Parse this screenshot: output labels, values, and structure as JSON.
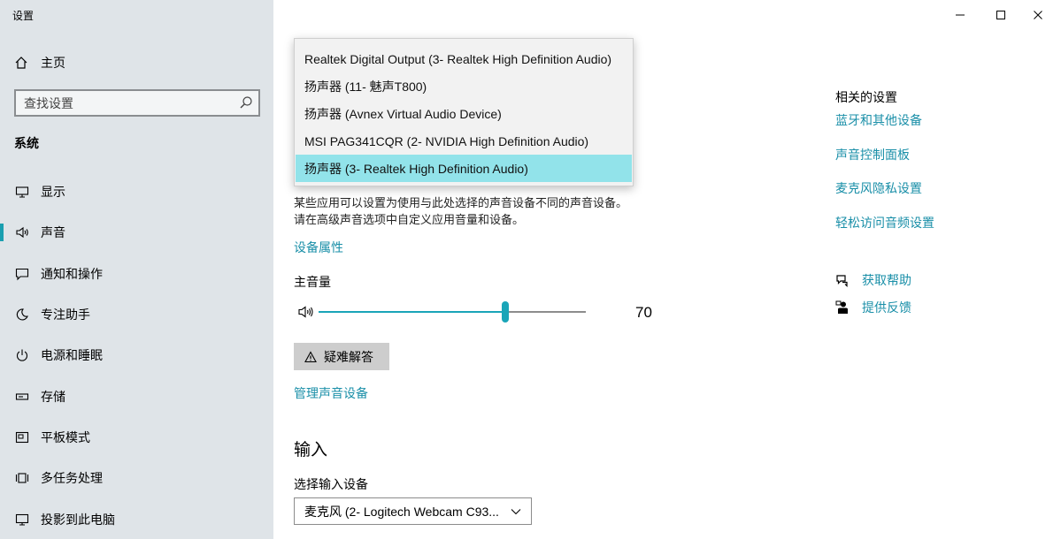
{
  "window": {
    "title": "设置",
    "minimize": "—",
    "maximize": "☐",
    "close": "✕"
  },
  "sidebar": {
    "home_label": "主页",
    "search_placeholder": "查找设置",
    "section_title": "系统",
    "items": [
      {
        "label": "显示",
        "icon": "monitor-icon"
      },
      {
        "label": "声音",
        "icon": "speaker-icon",
        "active": true
      },
      {
        "label": "通知和操作",
        "icon": "notification-icon"
      },
      {
        "label": "专注助手",
        "icon": "moon-icon"
      },
      {
        "label": "电源和睡眠",
        "icon": "power-icon"
      },
      {
        "label": "存储",
        "icon": "storage-icon"
      },
      {
        "label": "平板模式",
        "icon": "tablet-icon"
      },
      {
        "label": "多任务处理",
        "icon": "multitask-icon"
      },
      {
        "label": "投影到此电脑",
        "icon": "project-icon"
      }
    ]
  },
  "output": {
    "dropdown_options": [
      "Realtek Digital Output (3- Realtek High Definition Audio)",
      "扬声器 (11- 魅声T800)",
      "扬声器 (Avnex Virtual Audio Device)",
      "MSI PAG341CQR (2- NVIDIA High Definition Audio)",
      "扬声器 (3- Realtek High Definition Audio)"
    ],
    "selected_index": 4,
    "description_line1": "某些应用可以设置为使用与此处选择的声音设备不同的声音设备。",
    "description_line2": "请在高级声音选项中自定义应用音量和设备。",
    "device_properties_link": "设备属性",
    "master_volume_label": "主音量",
    "volume_value": "70",
    "volume_fraction": 0.7,
    "troubleshoot_label": "疑难解答",
    "manage_devices_link": "管理声音设备"
  },
  "input": {
    "heading": "输入",
    "select_label": "选择输入设备",
    "selected_device": "麦克风 (2- Logitech Webcam C93..."
  },
  "related": {
    "title": "相关的设置",
    "links": [
      "蓝牙和其他设备",
      "声音控制面板",
      "麦克风隐私设置",
      "轻松访问音频设置"
    ]
  },
  "help": {
    "get_help": "获取帮助",
    "feedback": "提供反馈"
  },
  "colors": {
    "accent": "#1a9fb0",
    "link": "#1a8fa8",
    "sidebar_bg": "#dfe4e8",
    "selected_option_bg": "#92e3ea"
  }
}
